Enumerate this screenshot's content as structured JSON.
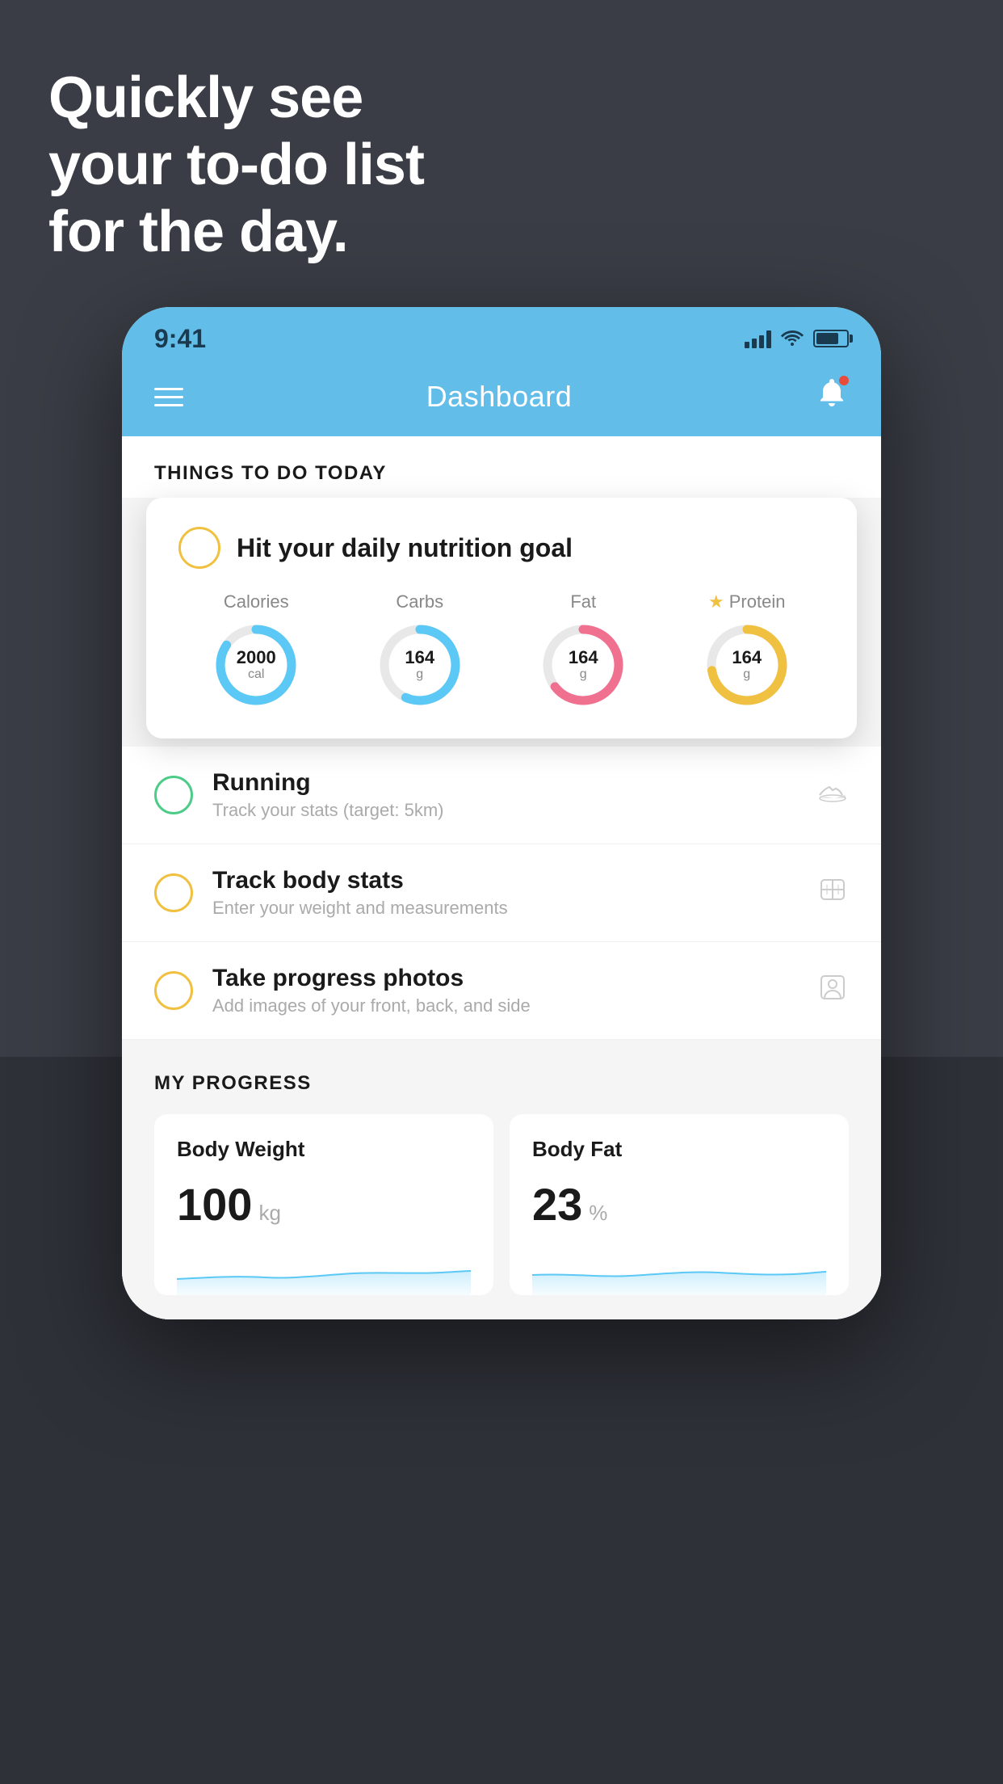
{
  "page": {
    "background_color": "#3a3d45"
  },
  "hero": {
    "line1": "Quickly see",
    "line2": "your to-do list",
    "line3": "for the day."
  },
  "phone": {
    "status_bar": {
      "time": "9:41"
    },
    "header": {
      "title": "Dashboard"
    },
    "section_label": "THINGS TO DO TODAY",
    "nutrition_card": {
      "title": "Hit your daily nutrition goal",
      "stats": [
        {
          "label": "Calories",
          "value": "2000",
          "unit": "cal",
          "color": "blue",
          "starred": false
        },
        {
          "label": "Carbs",
          "value": "164",
          "unit": "g",
          "color": "blue",
          "starred": false
        },
        {
          "label": "Fat",
          "value": "164",
          "unit": "g",
          "color": "pink",
          "starred": false
        },
        {
          "label": "Protein",
          "value": "164",
          "unit": "g",
          "color": "yellow",
          "starred": true
        }
      ]
    },
    "todo_items": [
      {
        "id": "running",
        "title": "Running",
        "subtitle": "Track your stats (target: 5km)",
        "circle_color": "green",
        "icon": "shoe"
      },
      {
        "id": "body-stats",
        "title": "Track body stats",
        "subtitle": "Enter your weight and measurements",
        "circle_color": "yellow",
        "icon": "scale"
      },
      {
        "id": "progress-photos",
        "title": "Take progress photos",
        "subtitle": "Add images of your front, back, and side",
        "circle_color": "yellow",
        "icon": "person"
      }
    ],
    "progress_section": {
      "title": "MY PROGRESS",
      "cards": [
        {
          "id": "body-weight",
          "title": "Body Weight",
          "value": "100",
          "unit": "kg"
        },
        {
          "id": "body-fat",
          "title": "Body Fat",
          "value": "23",
          "unit": "%"
        }
      ]
    }
  }
}
